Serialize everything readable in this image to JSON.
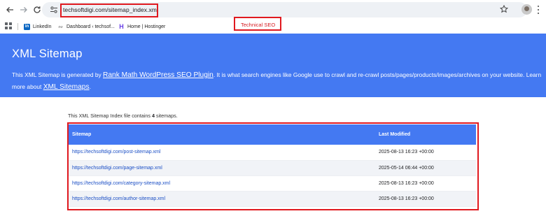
{
  "browser": {
    "url": "techsoftdigi.com/sitemap_index.xml",
    "bookmarks": [
      {
        "label": "LinkedIn",
        "icon": "linkedin-icon"
      },
      {
        "label": "Dashboard ‹ techsof...",
        "icon": "wordpress-icon"
      },
      {
        "label": "Home | Hostinger",
        "icon": "hostinger-icon"
      }
    ]
  },
  "annotation": {
    "tag": "Technical SEO",
    "color": "#e0191f"
  },
  "header": {
    "title": "XML Sitemap",
    "intro_prefix": "This XML Sitemap is generated by ",
    "plugin_link": "Rank Math WordPress SEO Plugin",
    "intro_middle": ". It is what search engines like Google use to crawl and re-crawl posts/pages/products/images/archives on your website. Learn more about ",
    "sitemaps_link": "XML Sitemaps",
    "intro_suffix": ".",
    "background_color": "#4479f2"
  },
  "content": {
    "count_prefix": "This XML Sitemap Index file contains ",
    "count": "4",
    "count_suffix": " sitemaps."
  },
  "table": {
    "columns": [
      "Sitemap",
      "Last Modified"
    ],
    "rows": [
      {
        "url": "https://techsoftdigi.com/post-sitemap.xml",
        "modified": "2025-08-13 16:23 +00:00"
      },
      {
        "url": "https://techsoftdigi.com/page-sitemap.xml",
        "modified": "2025-05-14 06:44 +00:00"
      },
      {
        "url": "https://techsoftdigi.com/category-sitemap.xml",
        "modified": "2025-08-13 16:23 +00:00"
      },
      {
        "url": "https://techsoftdigi.com/author-sitemap.xml",
        "modified": "2025-08-13 16:23 +00:00"
      }
    ]
  }
}
